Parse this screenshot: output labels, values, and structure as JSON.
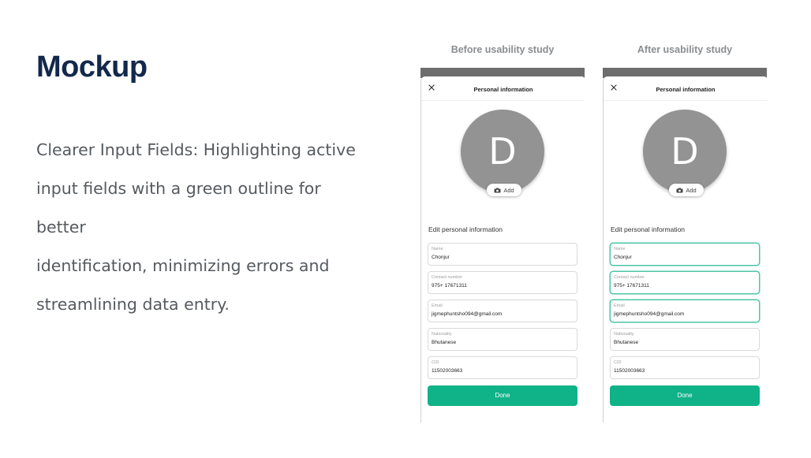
{
  "slide": {
    "title": "Mockup",
    "description_lines": [
      "Clearer Input Fields: Highlighting active",
      "input fields with a green outline for better",
      "identification, minimizing errors and",
      "streamlining data entry."
    ]
  },
  "colors": {
    "title": "#13294b",
    "accent_green": "#10b288",
    "active_outline": "#4cc6a6",
    "avatar_gray": "#939393"
  },
  "before": {
    "caption": "Before usability study",
    "header_title": "Personal information",
    "avatar_letter": "D",
    "add_label": "Add",
    "section_title": "Edit personal information",
    "fields": [
      {
        "label": "Name",
        "value": "Chonjur"
      },
      {
        "label": "Contact number",
        "value": "975+ 17671311"
      },
      {
        "label": "Email",
        "value": "jigmephuntsho094@gmail.com"
      },
      {
        "label": "Nationality",
        "value": "Bhutanese"
      },
      {
        "label": "CID",
        "value": "11502003663"
      }
    ],
    "done_label": "Done"
  },
  "after": {
    "caption": "After usability study",
    "header_title": "Personal information",
    "avatar_letter": "D",
    "add_label": "Add",
    "section_title": "Edit personal information",
    "fields": [
      {
        "label": "Name",
        "value": "Chonjur"
      },
      {
        "label": "Contact number",
        "value": "975+ 17671311"
      },
      {
        "label": "Email",
        "value": "jigmephuntsho094@gmail.com"
      },
      {
        "label": "Nationality",
        "value": "Bhutanese"
      },
      {
        "label": "CID",
        "value": "11502003663"
      }
    ],
    "done_label": "Done"
  },
  "icons": [
    "close-icon",
    "camera-icon"
  ]
}
